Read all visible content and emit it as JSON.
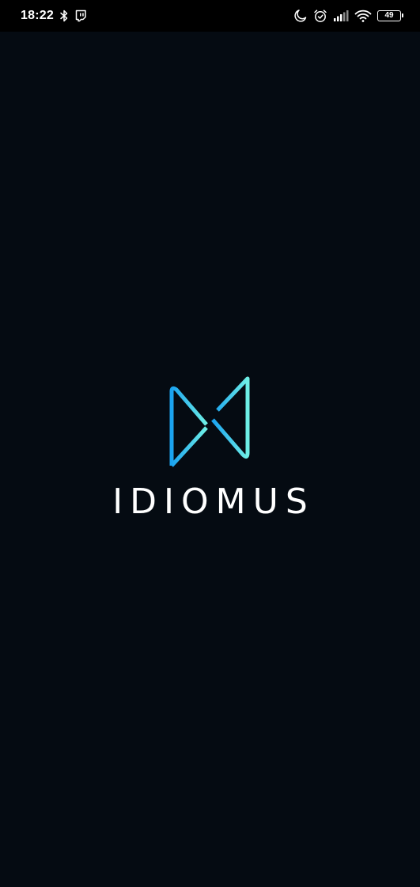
{
  "status_bar": {
    "time": "18:22",
    "left_icons": [
      "bluetooth-icon",
      "twitch-icon"
    ],
    "right_icons": [
      "moon-icon",
      "alarm-icon",
      "signal-icon",
      "wifi-icon"
    ],
    "battery_level": "49"
  },
  "splash": {
    "logo_icon": "idiomus-logo-icon",
    "brand_name": "IDIOMUS",
    "colors": {
      "background": "#050b12",
      "gradient_start": "#1aa3f0",
      "gradient_end": "#6ff0e6",
      "text": "#ffffff"
    }
  }
}
